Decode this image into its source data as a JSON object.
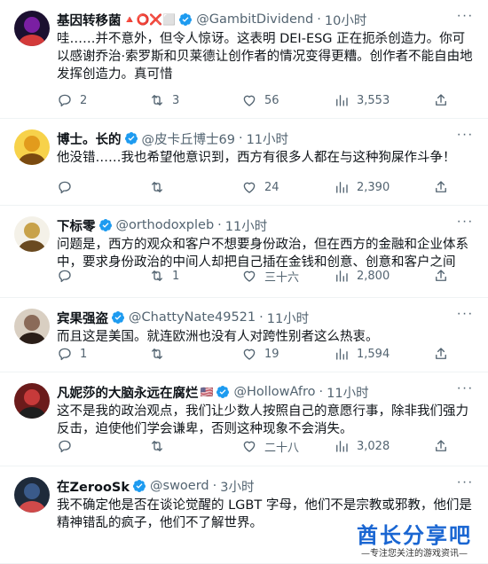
{
  "tweets": [
    {
      "name": "基因转移菌",
      "name_suffix": "🔺⭕❌⬜",
      "handle": "@GambitDividend",
      "time": "10小时",
      "text": "哇……并不意外，但令人惊讶。这表明 DEI-ESG 正在扼杀创造力。你可以感谢乔治·索罗斯和贝莱德让创作者的情况变得更糟。创作者不能自由地发挥创造力。真可惜",
      "replies": "2",
      "reposts": "3",
      "likes": "56",
      "views": "3,553"
    },
    {
      "name": "博士。长的",
      "name_suffix": "",
      "handle": "@皮卡丘博士69",
      "time": "11小时",
      "text": "他没错……我也希望他意识到，西方有很多人都在与这种狗屎作斗争！",
      "replies": "",
      "reposts": "",
      "likes": "24",
      "views": "2,390"
    },
    {
      "name": "下标零",
      "name_suffix": "",
      "handle": "@orthodoxpleb",
      "time": "11小时",
      "text": "问题是，西方的观众和客户不想要身份政治，但在西方的金融和企业体系中，要求身份政治的中间人却把自己插在金钱和创意、创意和客户之间",
      "replies": "",
      "reposts": "1",
      "likes": "三十六",
      "views": "2,800"
    },
    {
      "name": "宾果强盗",
      "name_suffix": "",
      "handle": "@ChattyNate49521",
      "time": "11小时",
      "text": "而且这是美国。就连欧洲也没有人对跨性别者这么热衷。",
      "replies": "1",
      "reposts": "",
      "likes": "19",
      "views": "1,594"
    },
    {
      "name": "凡妮莎的大脑永远在腐烂",
      "name_suffix": "🇺🇸",
      "handle": "@HollowAfro",
      "time": "11小时",
      "text": "这不是我的政治观点，我们让少数人按照自己的意愿行事，除非我们强力反击，迫使他们学会谦卑，否则这种现象不会消失。",
      "replies": "",
      "reposts": "",
      "likes": "二十八",
      "views": "3,028"
    },
    {
      "name": "在ZerooSk",
      "name_suffix": "",
      "handle": "@swoerd",
      "time": "3小时",
      "text": "我不确定他是否在谈论觉醒的 LGBT 字母，他们不是宗教或邪教，他们是精神错乱的疯子，他们不了解世界。",
      "replies": "",
      "reposts": "",
      "likes": "",
      "views": ""
    }
  ],
  "watermark": {
    "title": "酋长分享吧",
    "subtitle": "—专注您关注的游戏资讯—"
  },
  "colors": {
    "text": "#0f1419",
    "muted": "#536471",
    "verified": "#1d9bf0",
    "divider": "#eff3f4",
    "watermark": "#1a66d2"
  },
  "icons": [
    "reply-icon",
    "repost-icon",
    "like-icon",
    "views-icon",
    "share-icon",
    "verified-badge-icon",
    "more-icon"
  ]
}
